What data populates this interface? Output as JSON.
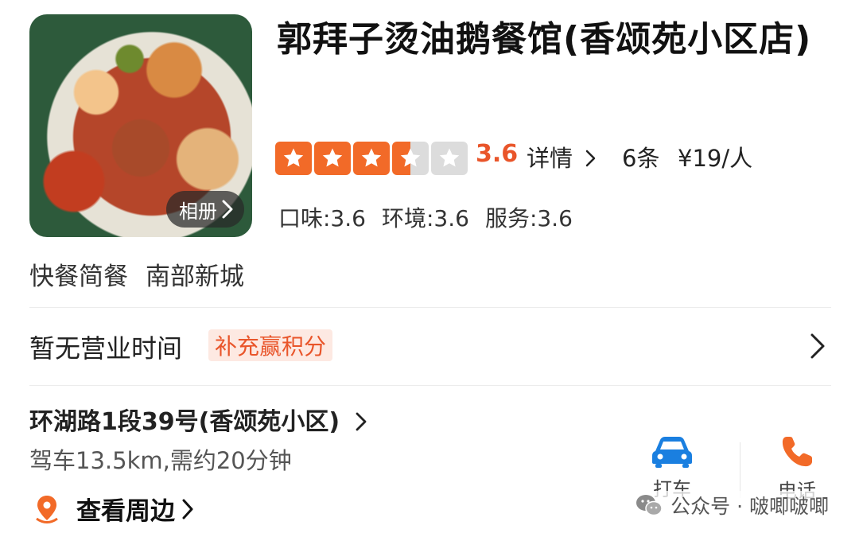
{
  "restaurant": {
    "name": "郭拜子烫油鹅餐馆(香颂苑小区店)",
    "album_label": "相册",
    "rating": 3.6,
    "score_text": "3.6",
    "detail_label": "详情",
    "review_count": "6条",
    "price": "¥19/人",
    "subscores": {
      "taste": "口味:3.6",
      "environment": "环境:3.6",
      "service": "服务:3.6"
    },
    "category": "快餐简餐",
    "area": "南部新城"
  },
  "hours": {
    "text": "暂无营业时间",
    "points_label": "补充赢积分"
  },
  "location": {
    "address": "环湖路1段39号(香颂苑小区)",
    "distance": "驾车13.5km,需约20分钟",
    "nearby_label": "查看周边"
  },
  "actions": {
    "taxi_label": "打车",
    "phone_label": "电话"
  },
  "watermark": {
    "text": "公众号 · 啵唧啵唧"
  },
  "colors": {
    "accent": "#e9552a",
    "star": "#f26a28",
    "taxi": "#1a7fe0"
  }
}
